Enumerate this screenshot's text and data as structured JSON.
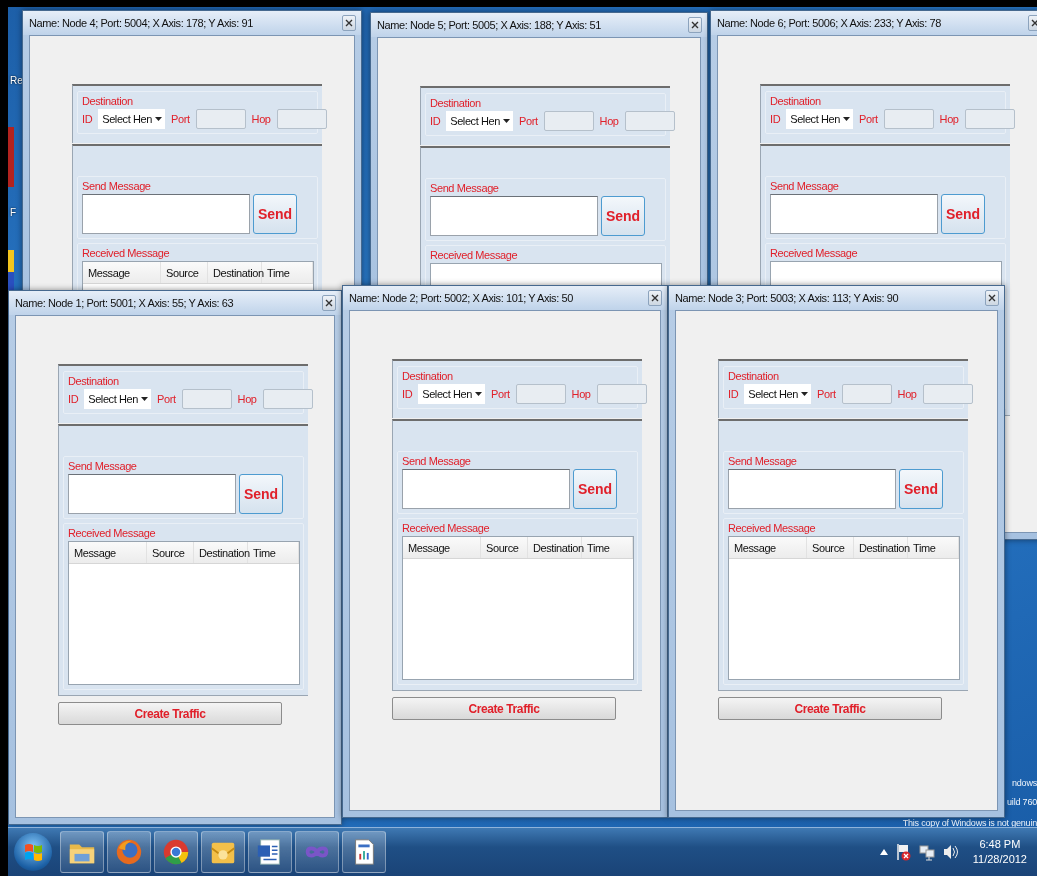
{
  "desktop": {
    "icon_labels": [
      "Re",
      "F"
    ],
    "activation_notice": [
      "ndows",
      "uild 760",
      "This copy of Windows is not genuin"
    ]
  },
  "windows": [
    {
      "title": "Name: Node 4; Port: 5004; X Axis: 178; Y Axis: 91",
      "kind": "back",
      "destination_label": "Destination",
      "id_label": "ID",
      "id_select": "Select Hen",
      "port_label": "Port",
      "hop_label": "Hop",
      "send_label": "Send Message",
      "send_button": "Send",
      "received_label": "Received Message",
      "columns": [
        "Message",
        "Source",
        "Destination",
        "Time"
      ]
    },
    {
      "title": "Name: Node 5; Port: 5005; X Axis: 188; Y Axis: 51",
      "kind": "back",
      "destination_label": "Destination",
      "id_label": "ID",
      "id_select": "Select Hen",
      "port_label": "Port",
      "hop_label": "Hop",
      "send_label": "Send Message",
      "send_button": "Send",
      "received_label": "Received Message"
    },
    {
      "title": "Name: Node 6; Port: 5006; X Axis: 233; Y Axis: 78",
      "kind": "back",
      "destination_label": "Destination",
      "id_label": "ID",
      "id_select": "Select Hen",
      "port_label": "Port",
      "hop_label": "Hop",
      "send_label": "Send Message",
      "send_button": "Send",
      "received_label": "Received Message"
    },
    {
      "title": "Name: Node 1; Port: 5001; X Axis: 55; Y Axis: 63",
      "kind": "front",
      "destination_label": "Destination",
      "id_label": "ID",
      "id_select": "Select Hen",
      "port_label": "Port",
      "hop_label": "Hop",
      "send_label": "Send Message",
      "send_button": "Send",
      "received_label": "Received Message",
      "columns": [
        "Message",
        "Source",
        "Destination",
        "Time"
      ],
      "traffic_button": "Create Traffic"
    },
    {
      "title": "Name: Node 2; Port: 5002; X Axis: 101; Y Axis: 50",
      "kind": "front",
      "destination_label": "Destination",
      "id_label": "ID",
      "id_select": "Select Hen",
      "port_label": "Port",
      "hop_label": "Hop",
      "send_label": "Send Message",
      "send_button": "Send",
      "received_label": "Received Message",
      "columns": [
        "Message",
        "Source",
        "Destination",
        "Time"
      ],
      "traffic_button": "Create Traffic"
    },
    {
      "title": "Name: Node 3; Port: 5003; X Axis: 113; Y Axis: 90",
      "kind": "front",
      "destination_label": "Destination",
      "id_label": "ID",
      "id_select": "Select Hen",
      "port_label": "Port",
      "hop_label": "Hop",
      "send_label": "Send Message",
      "send_button": "Send",
      "received_label": "Received Message",
      "columns": [
        "Message",
        "Source",
        "Destination",
        "Time"
      ],
      "traffic_button": "Create Traffic"
    }
  ],
  "taskbar": {
    "time": "6:48 PM",
    "date": "11/28/2012"
  }
}
